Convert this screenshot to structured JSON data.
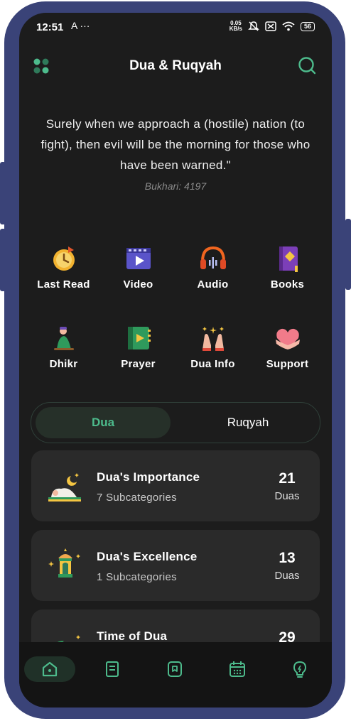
{
  "status_bar": {
    "time": "12:51",
    "extra_icons": "A ···",
    "net_speed_top": "0.05",
    "net_speed_bottom": "KB/s",
    "battery": "56"
  },
  "header": {
    "title": "Dua & Ruqyah",
    "menu_icon": "grid-menu-icon",
    "search_icon": "search-icon"
  },
  "quote": {
    "text": "Surely when we approach a (hostile) nation (to fight), then evil will be the morning for those who have been warned.\"",
    "reference": "Bukhari: 4197"
  },
  "categories": [
    {
      "label": "Last Read",
      "icon": "last-read-icon"
    },
    {
      "label": "Video",
      "icon": "video-icon"
    },
    {
      "label": "Audio",
      "icon": "headphones-icon"
    },
    {
      "label": "Books",
      "icon": "books-icon"
    },
    {
      "label": "Dhikr",
      "icon": "dhikr-icon"
    },
    {
      "label": "Prayer",
      "icon": "prayer-icon"
    },
    {
      "label": "Dua Info",
      "icon": "dua-hands-icon"
    },
    {
      "label": "Support",
      "icon": "heart-hands-icon"
    }
  ],
  "tabs": {
    "active": "Dua",
    "inactive": "Ruqyah"
  },
  "cards": [
    {
      "title": "Dua's Importance",
      "subtitle": "7 Subcategories",
      "count": "21",
      "unit": "Duas",
      "icon": "prostration-icon"
    },
    {
      "title": "Dua's Excellence",
      "subtitle": "1 Subcategories",
      "count": "13",
      "unit": "Duas",
      "icon": "lantern-icon"
    },
    {
      "title": "Time of Dua",
      "subtitle": "",
      "count": "29",
      "unit": "",
      "icon": "moon-icon"
    }
  ],
  "bottom_nav": [
    "home-icon",
    "book-icon",
    "bookmark-icon",
    "calendar-icon",
    "bulb-icon"
  ],
  "colors": {
    "accent": "#4dbb8c",
    "background": "#1c1c1c",
    "card": "#2a2a2a",
    "frame": "#3a4378"
  }
}
